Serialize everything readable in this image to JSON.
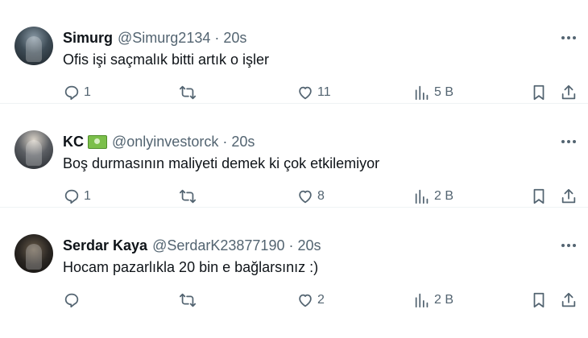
{
  "tweets": [
    {
      "name": "Simurg",
      "handle": "@Simurg2134",
      "time": "20s",
      "text": "Ofis işi saçmalık bitti artık o işler",
      "replies": "1",
      "retweets": "",
      "likes": "11",
      "views": "5 B",
      "badge": false
    },
    {
      "name": "KC",
      "handle": "@onlyinvestorck",
      "time": "20s",
      "text": "Boş durmasının maliyeti demek ki çok etkilemiyor",
      "replies": "1",
      "retweets": "",
      "likes": "8",
      "views": "2 B",
      "badge": true
    },
    {
      "name": "Serdar Kaya",
      "handle": "@SerdarK23877190",
      "time": "20s",
      "text": "Hocam pazarlıkla 20 bin e bağlarsınız :)",
      "replies": "",
      "retweets": "",
      "likes": "2",
      "views": "2 B",
      "badge": false
    }
  ],
  "separator": "·",
  "icons": {
    "reply": "reply-icon",
    "retweet": "retweet-icon",
    "like": "heart-icon",
    "views": "views-chart-icon",
    "bookmark": "bookmark-icon",
    "share": "share-icon",
    "more": "more-dots-icon",
    "badge": "money-emoji-icon"
  },
  "colors": {
    "text": "#0f1419",
    "secondary": "#536471",
    "border": "#eff3f4",
    "background": "#ffffff"
  }
}
